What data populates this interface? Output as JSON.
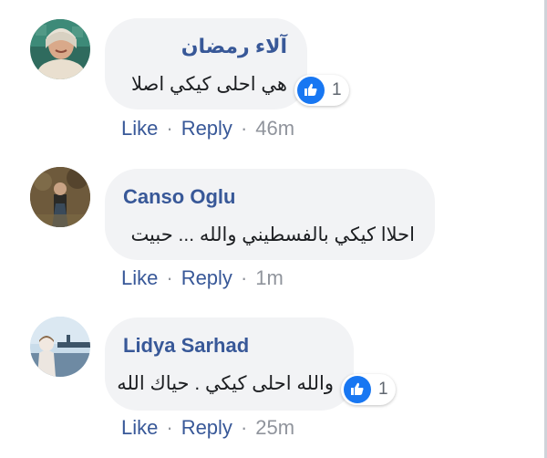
{
  "comments": [
    {
      "author": "آلاء رمضان",
      "text": "هي احلى كيكي اصلا",
      "reaction_count": "1",
      "like_label": "Like",
      "reply_label": "Reply",
      "separator": "·",
      "time": "46m",
      "reaction_icon": "thumbs-up-icon"
    },
    {
      "author": "Canso Oglu",
      "text": "احلاا كيكي بالفسطيني والله ... حبيت",
      "like_label": "Like",
      "reply_label": "Reply",
      "separator": "·",
      "time": "1m"
    },
    {
      "author": "Lidya Sarhad",
      "text": "والله احلى كيكي . حياك الله",
      "reaction_count": "1",
      "like_label": "Like",
      "reply_label": "Reply",
      "separator": "·",
      "time": "25m",
      "reaction_icon": "thumbs-up-icon"
    }
  ],
  "colors": {
    "name": "#385898",
    "bubble": "#f2f3f5",
    "like_blue": "#1877f2",
    "meta_gray": "#90949c"
  }
}
